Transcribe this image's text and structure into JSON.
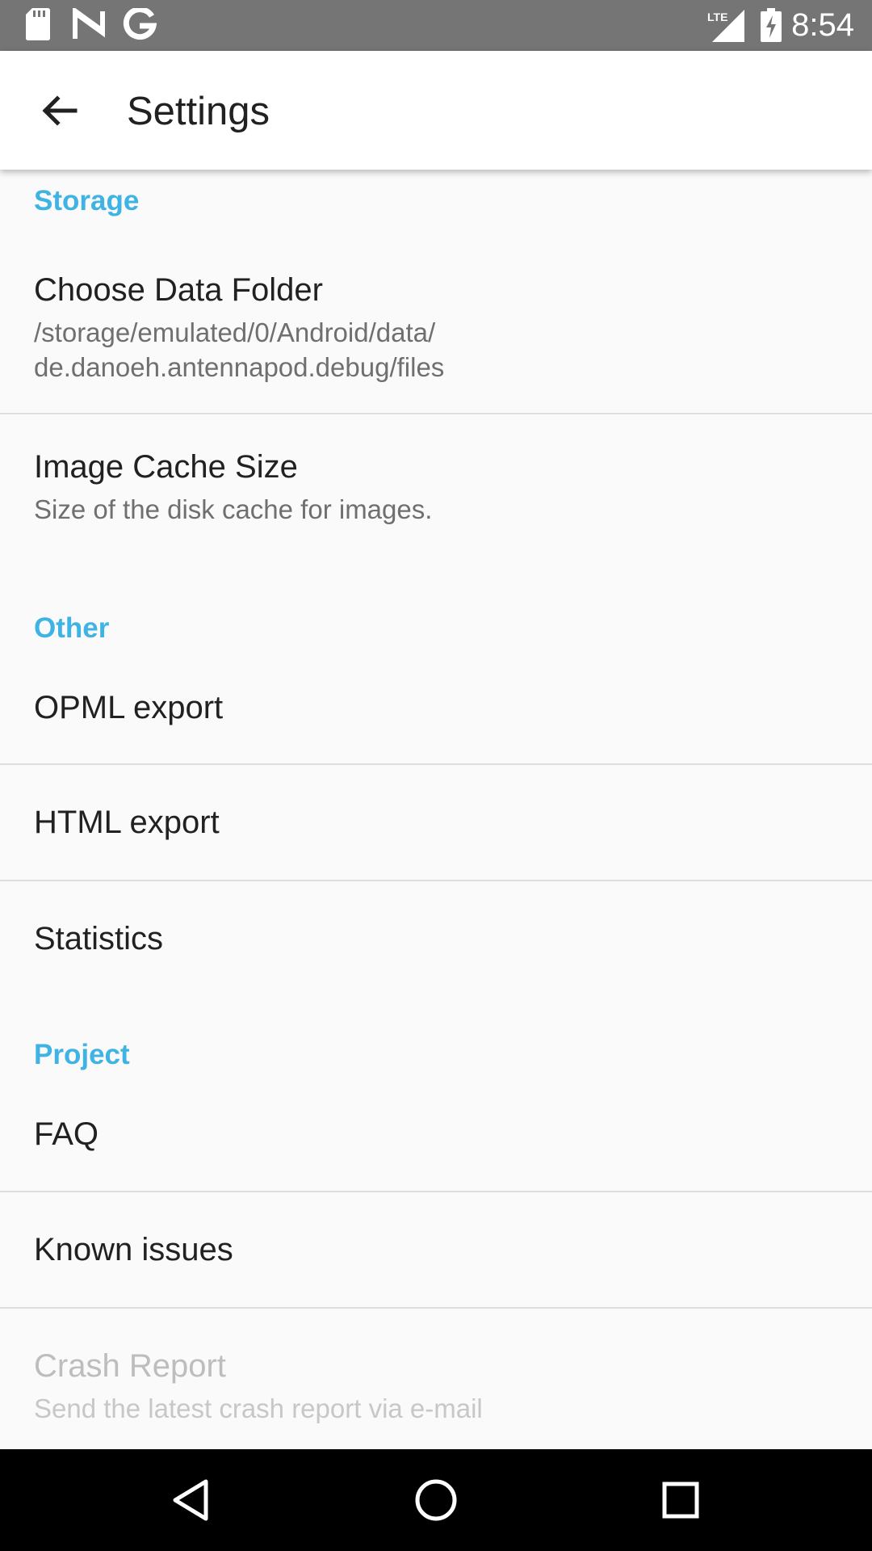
{
  "status_bar": {
    "time": "8:54",
    "network_label": "LTE",
    "icons": [
      "sd-card-icon",
      "n-logo-icon",
      "google-icon",
      "signal-icon",
      "battery-charging-icon"
    ]
  },
  "toolbar": {
    "title": "Settings",
    "back_icon": "arrow-back-icon"
  },
  "sections": [
    {
      "header": "Storage",
      "items": [
        {
          "title": "Choose Data Folder",
          "summary": "/storage/emulated/0/Android/data/\nde.danoeh.antennapod.debug/files"
        },
        {
          "title": "Image Cache Size",
          "summary": "Size of the disk cache for images."
        }
      ]
    },
    {
      "header": "Other",
      "items": [
        {
          "title": "OPML export"
        },
        {
          "title": "HTML export"
        },
        {
          "title": "Statistics"
        }
      ]
    },
    {
      "header": "Project",
      "items": [
        {
          "title": "FAQ"
        },
        {
          "title": "Known issues"
        },
        {
          "title": "Crash Report",
          "summary": "Send the latest crash report via e-mail",
          "enabled": false
        }
      ]
    }
  ],
  "nav_bar": {
    "icons": [
      "nav-back-icon",
      "nav-home-icon",
      "nav-recents-icon"
    ]
  },
  "colors": {
    "accent": "#3fb3e3",
    "status_bar": "#757575",
    "background": "#fafafa",
    "nav_bar": "#000000"
  }
}
